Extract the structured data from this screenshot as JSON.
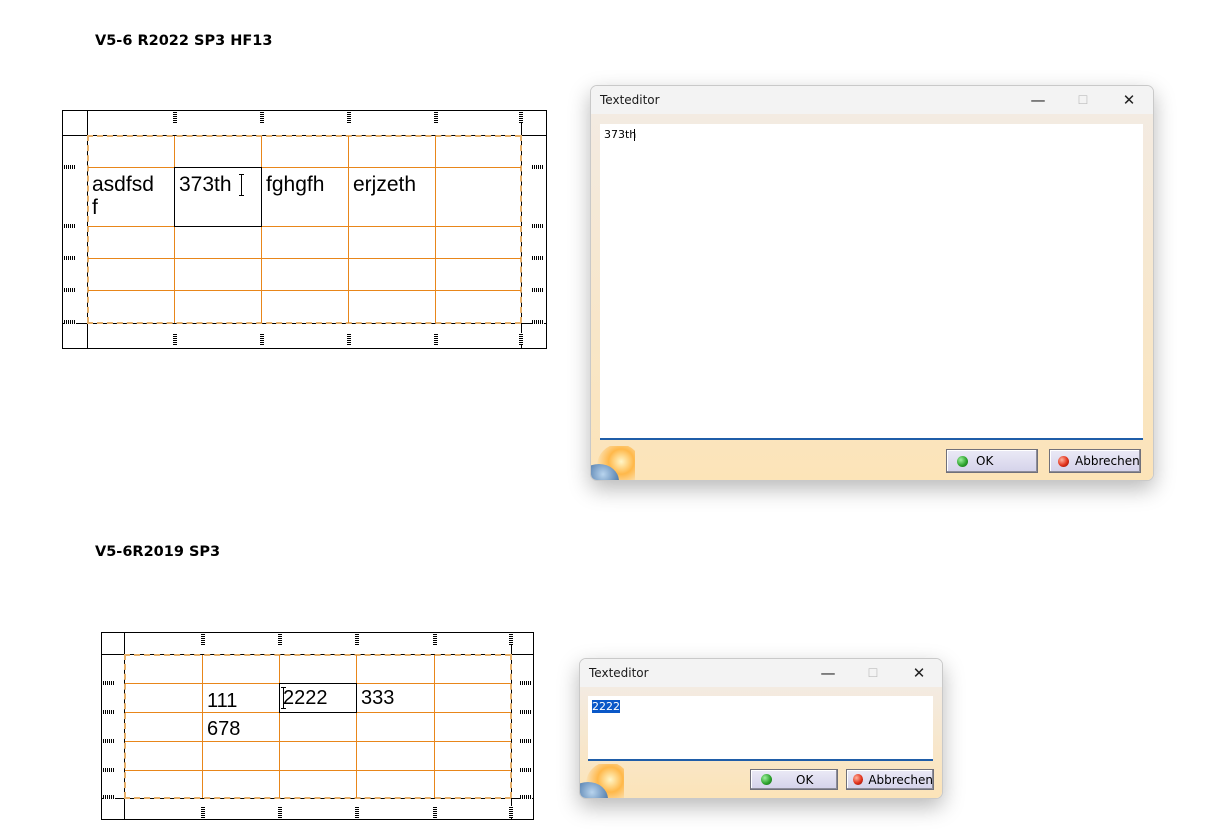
{
  "section_top": {
    "heading": "V5-6 R2022 SP3 HF13",
    "cells": {
      "a": "asdfsd\nf",
      "b": "373th",
      "c": "fghgfh",
      "d": "erjzeth"
    },
    "dialog": {
      "title": "Texteditor",
      "minimize_icon": "minimize-icon",
      "maximize_icon": "maximize-icon",
      "close_icon": "close-icon",
      "text": "373th",
      "ok_label": "OK",
      "cancel_label": "Abbrechen"
    }
  },
  "section_bottom": {
    "heading": "V5-6R2019 SP3",
    "cells": {
      "a": "111\n678",
      "b": "2222",
      "c": "333"
    },
    "dialog": {
      "title": "Texteditor",
      "text": "2222",
      "ok_label": "OK",
      "cancel_label": "Abbrechen"
    }
  },
  "colors": {
    "grid": "#e8861a",
    "accent": "#1f5da8",
    "selection": "#0a58c8"
  }
}
